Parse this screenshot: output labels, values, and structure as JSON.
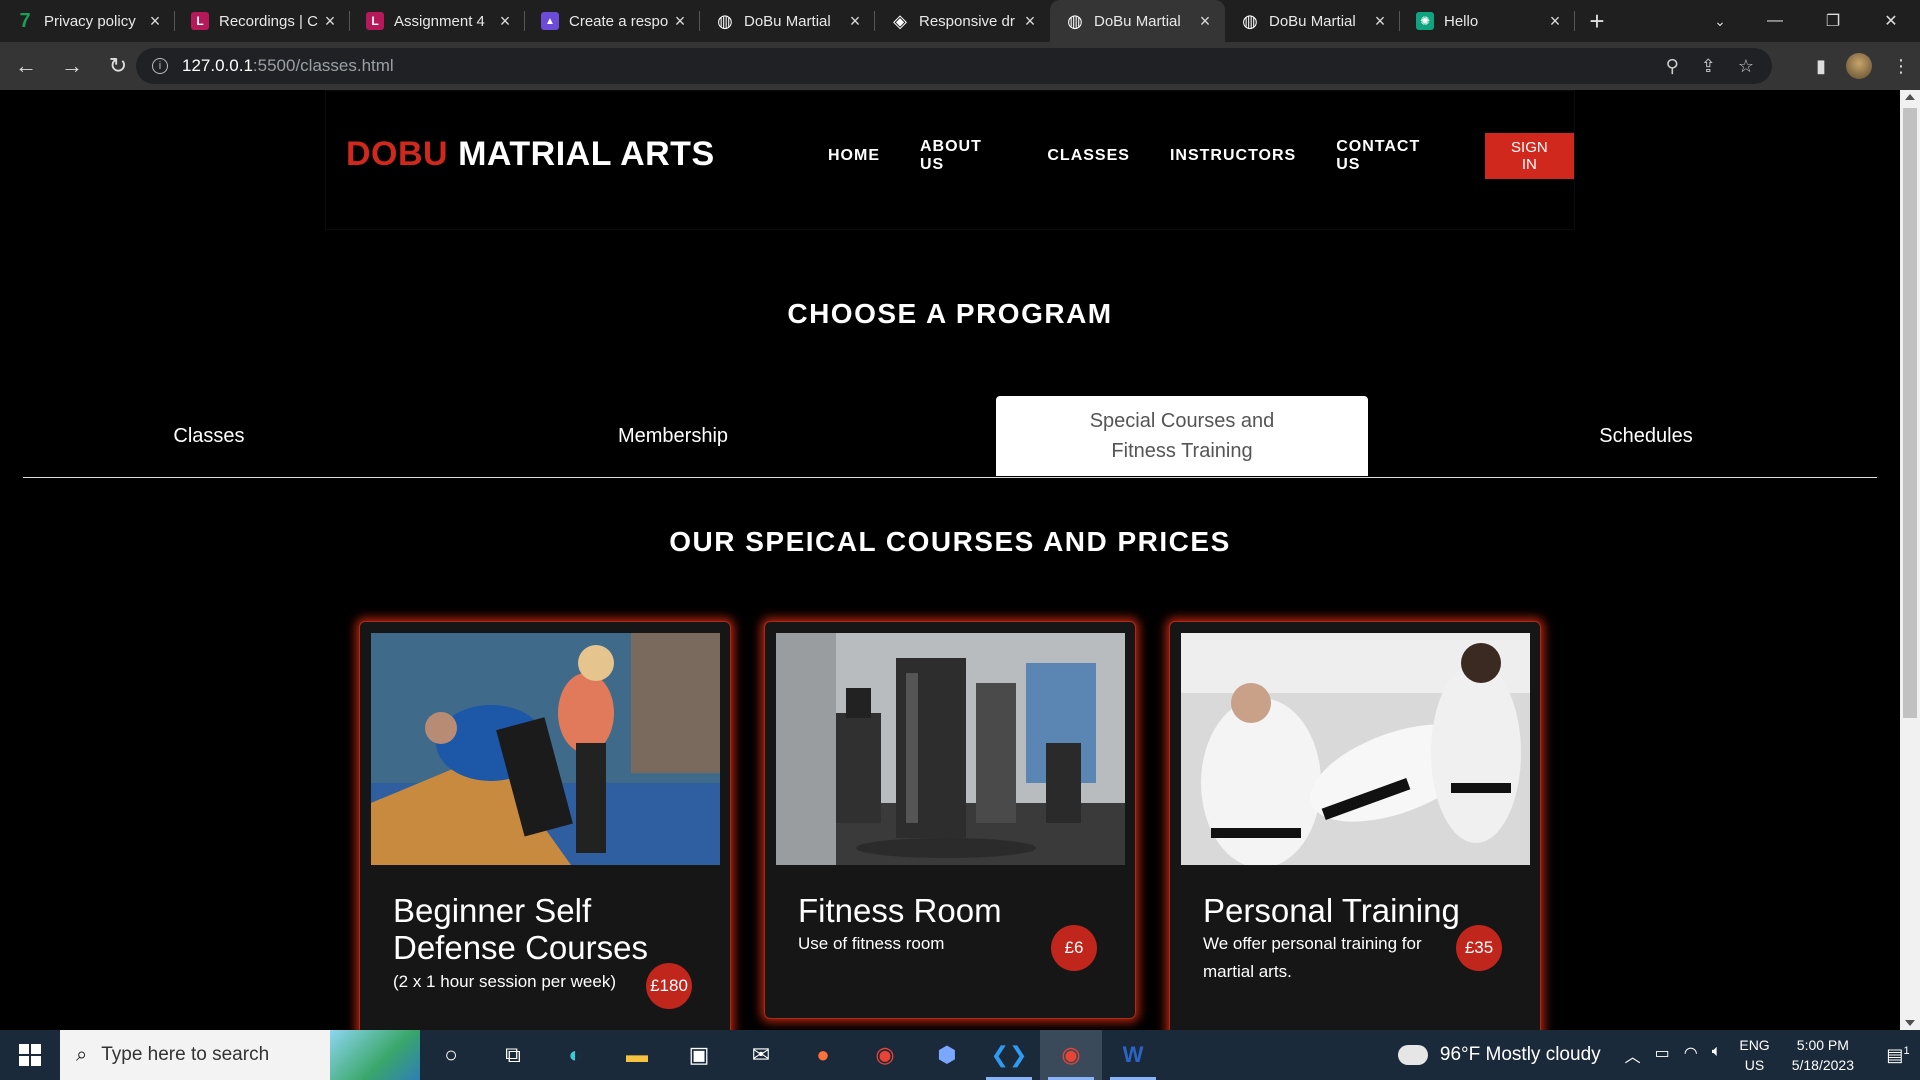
{
  "browser": {
    "tabs": [
      {
        "label": "Privacy policy",
        "icon": "seven-icon",
        "color": "#1aa053",
        "glyph": "7"
      },
      {
        "label": "Recordings | C",
        "icon": "l-icon",
        "color": "#b5195a",
        "glyph": "L"
      },
      {
        "label": "Assignment 4",
        "icon": "l-icon",
        "color": "#b5195a",
        "glyph": "L"
      },
      {
        "label": "Create a respo",
        "icon": "rocket-icon",
        "color": "#6b4bd8",
        "glyph": "▲"
      },
      {
        "label": "DoBu Martial",
        "icon": "globe-icon",
        "color": "#ffffff",
        "glyph": "◍"
      },
      {
        "label": "Responsive dr",
        "icon": "codepen-icon",
        "color": "#ffffff",
        "glyph": "◈"
      },
      {
        "label": "DoBu Martial",
        "icon": "globe-icon",
        "color": "#ffffff",
        "glyph": "◍",
        "active": true
      },
      {
        "label": "DoBu Martial",
        "icon": "globe-icon",
        "color": "#ffffff",
        "glyph": "◍"
      },
      {
        "label": "Hello",
        "icon": "openai-icon",
        "color": "#10a37f",
        "glyph": "✺"
      }
    ],
    "url_host": "127.0.0.1",
    "url_path": ":5500/classes.html"
  },
  "site": {
    "logo_red": "DOBU",
    "logo_white": "MATRIAL ARTS",
    "nav": [
      "HOME",
      "ABOUT US",
      "CLASSES",
      "INSTRUCTORS",
      "CONTACT US"
    ],
    "signin": "SIGN IN",
    "accent": "#d0281d"
  },
  "program": {
    "heading": "CHOOSE A PROGRAM",
    "tabs": [
      "Classes",
      "Membership",
      "Special Courses and Fitness Training",
      "Schedules"
    ],
    "active_tab": "Special Courses and Fitness Training"
  },
  "courses": {
    "heading": "OUR SPEICAL COURSES AND PRICES",
    "items": [
      {
        "title": "Beginner Self Defense Courses",
        "desc": "(2 x 1 hour session per week)",
        "price": "£180",
        "photo": "self-defense-photo"
      },
      {
        "title": "Fitness Room",
        "desc": "Use of fitness room",
        "price": "£6",
        "photo": "gym-photo"
      },
      {
        "title": "Personal Training",
        "desc": "We offer personal training for martial arts.",
        "price": "£35",
        "photo": "karate-photo"
      }
    ]
  },
  "taskbar": {
    "search_placeholder": "Type here to search",
    "weather": "96°F  Mostly cloudy",
    "lang_top": "ENG",
    "lang_bottom": "US",
    "time": "5:00 PM",
    "date": "5/18/2023",
    "notif_count": "1"
  }
}
